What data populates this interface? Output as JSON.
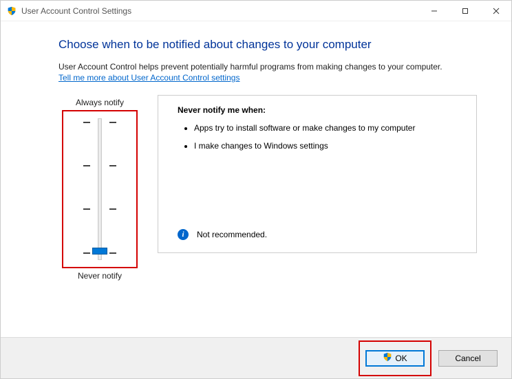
{
  "titlebar": {
    "title": "User Account Control Settings"
  },
  "content": {
    "heading": "Choose when to be notified about changes to your computer",
    "description": "User Account Control helps prevent potentially harmful programs from making changes to your computer.",
    "link": "Tell me more about User Account Control settings"
  },
  "slider": {
    "top_label": "Always notify",
    "bottom_label": "Never notify",
    "position": 3,
    "levels": 4
  },
  "detail": {
    "title": "Never notify me when:",
    "bullets": [
      "Apps try to install software or make changes to my computer",
      "I make changes to Windows settings"
    ],
    "recommendation": "Not recommended."
  },
  "footer": {
    "ok_label": "OK",
    "cancel_label": "Cancel"
  }
}
